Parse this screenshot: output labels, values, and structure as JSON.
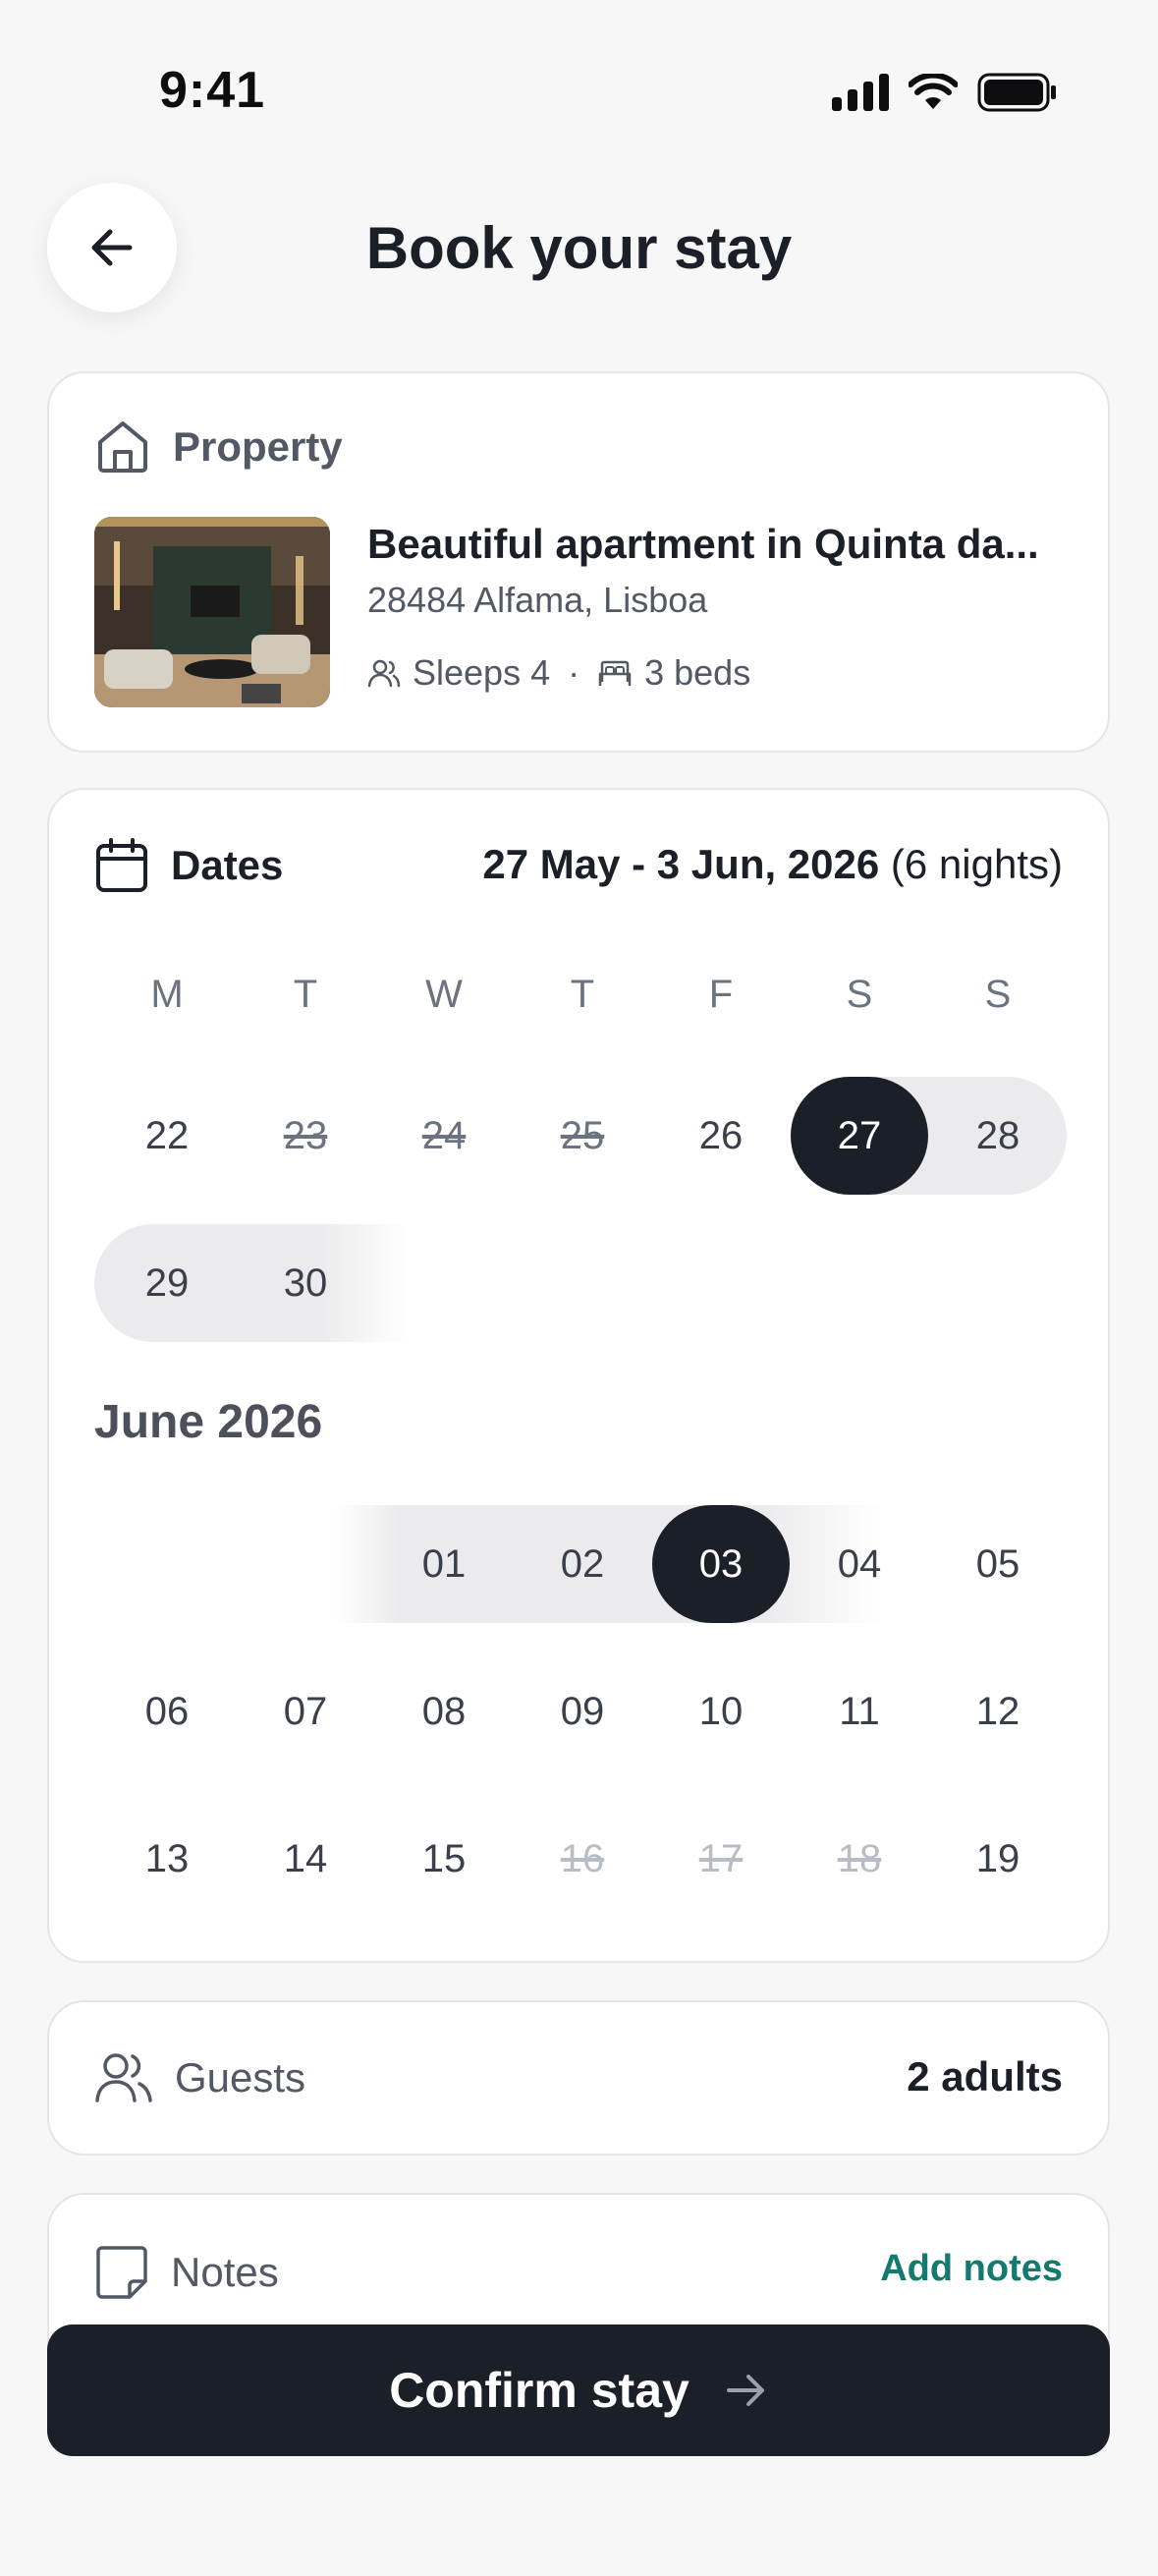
{
  "status_bar": {
    "time": "9:41",
    "icons": [
      "signal-icon",
      "wifi-icon",
      "battery-icon"
    ]
  },
  "header": {
    "title": "Book your stay",
    "back_icon": "arrow-left-icon"
  },
  "property": {
    "section_label": "Property",
    "name": "Beautiful apartment in Quinta da...",
    "address": "28484 Alfama, Lisboa",
    "sleeps": "Sleeps 4",
    "separator": "·",
    "beds": "3 beds"
  },
  "dates": {
    "section_label": "Dates",
    "range": "27 May - 3 Jun, 2026",
    "nights": "(6 nights)",
    "weekdays": [
      "M",
      "T",
      "W",
      "T",
      "F",
      "S",
      "S"
    ],
    "may_days": [
      {
        "label": "22",
        "state": "available"
      },
      {
        "label": "23",
        "state": "disabled"
      },
      {
        "label": "24",
        "state": "disabled"
      },
      {
        "label": "25",
        "state": "disabled"
      },
      {
        "label": "26",
        "state": "available"
      },
      {
        "label": "27",
        "state": "selected-start"
      },
      {
        "label": "28",
        "state": "in-range"
      },
      {
        "label": "29",
        "state": "in-range"
      },
      {
        "label": "30",
        "state": "in-range"
      }
    ],
    "june_label": "June 2026",
    "june_days": [
      {
        "label": "01",
        "state": "in-range"
      },
      {
        "label": "02",
        "state": "in-range"
      },
      {
        "label": "03",
        "state": "selected-end"
      },
      {
        "label": "04",
        "state": "available"
      },
      {
        "label": "05",
        "state": "available"
      },
      {
        "label": "06",
        "state": "available"
      },
      {
        "label": "07",
        "state": "available"
      },
      {
        "label": "08",
        "state": "available"
      },
      {
        "label": "09",
        "state": "available"
      },
      {
        "label": "10",
        "state": "available"
      },
      {
        "label": "11",
        "state": "available"
      },
      {
        "label": "12",
        "state": "available"
      },
      {
        "label": "13",
        "state": "available"
      },
      {
        "label": "14",
        "state": "available"
      },
      {
        "label": "15",
        "state": "available"
      },
      {
        "label": "16",
        "state": "unavailable"
      },
      {
        "label": "17",
        "state": "unavailable"
      },
      {
        "label": "18",
        "state": "unavailable"
      },
      {
        "label": "19",
        "state": "available"
      }
    ]
  },
  "guests": {
    "section_label": "Guests",
    "value": "2 adults"
  },
  "notes": {
    "section_label": "Notes",
    "action": "Add notes"
  },
  "confirm": {
    "label": "Confirm stay"
  },
  "colors": {
    "primary": "#1b1f27",
    "accent": "#137b6e",
    "range": "#ebebed",
    "muted": "#525965"
  }
}
